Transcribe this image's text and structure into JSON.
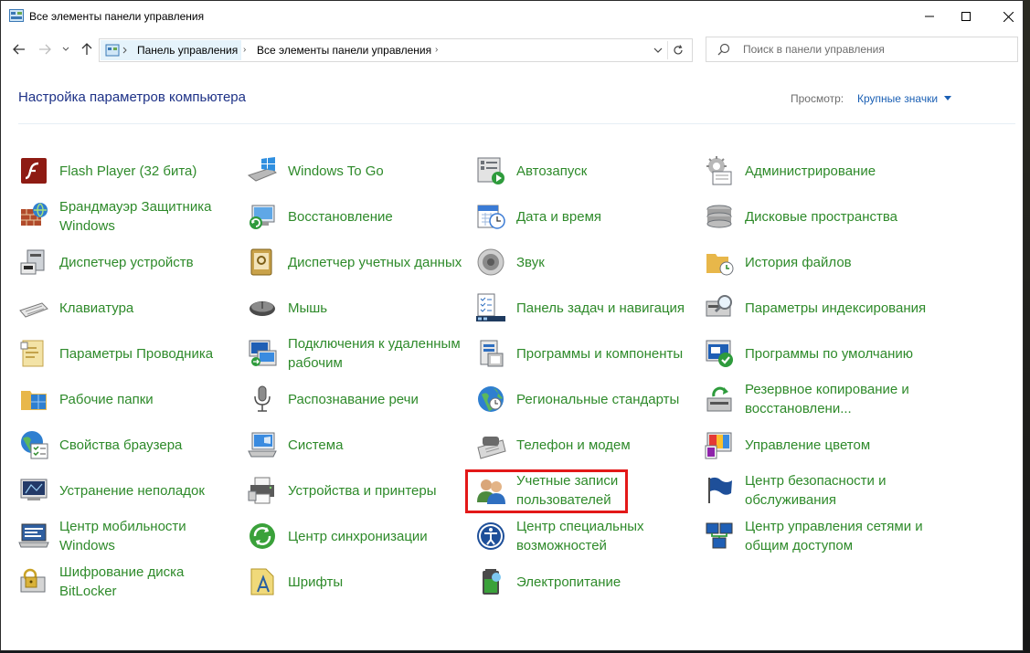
{
  "window": {
    "title": "Все элементы панели управления"
  },
  "address": {
    "crumbs": [
      "Панель управления",
      "Все элементы панели управления"
    ]
  },
  "search": {
    "placeholder": "Поиск в панели управления"
  },
  "header": {
    "title": "Настройка параметров компьютера",
    "view_label": "Просмотр:",
    "view_value": "Крупные значки"
  },
  "items": [
    {
      "label": "Flash Player (32 бита)",
      "icon": "flash-icon"
    },
    {
      "label": "Брандмауэр Защитника Windows",
      "icon": "firewall-icon"
    },
    {
      "label": "Диспетчер устройств",
      "icon": "device-manager-icon"
    },
    {
      "label": "Клавиатура",
      "icon": "keyboard-icon"
    },
    {
      "label": "Параметры Проводника",
      "icon": "explorer-options-icon"
    },
    {
      "label": "Рабочие папки",
      "icon": "work-folders-icon"
    },
    {
      "label": "Свойства браузера",
      "icon": "browser-icon"
    },
    {
      "label": "Устранение неполадок",
      "icon": "troubleshoot-icon"
    },
    {
      "label": "Центр мобильности Windows",
      "icon": "mobility-icon"
    },
    {
      "label": "Шифрование диска BitLocker",
      "icon": "bitlocker-icon"
    },
    {
      "label": "Windows To Go",
      "icon": "windows-to-go-icon"
    },
    {
      "label": "Восстановление",
      "icon": "recovery-icon"
    },
    {
      "label": "Диспетчер учетных данных",
      "icon": "credential-manager-icon"
    },
    {
      "label": "Мышь",
      "icon": "mouse-icon"
    },
    {
      "label": "Подключения к удаленным рабочим",
      "icon": "remote-desktop-icon"
    },
    {
      "label": "Распознавание речи",
      "icon": "microphone-icon"
    },
    {
      "label": "Система",
      "icon": "system-icon"
    },
    {
      "label": "Устройства и принтеры",
      "icon": "printer-icon"
    },
    {
      "label": "Центр синхронизации",
      "icon": "sync-icon"
    },
    {
      "label": "Шрифты",
      "icon": "fonts-icon"
    },
    {
      "label": "Автозапуск",
      "icon": "autoplay-icon"
    },
    {
      "label": "Дата и время",
      "icon": "calendar-icon"
    },
    {
      "label": "Звук",
      "icon": "speaker-icon"
    },
    {
      "label": "Панель задач и навигация",
      "icon": "taskbar-icon"
    },
    {
      "label": "Программы и компоненты",
      "icon": "programs-icon"
    },
    {
      "label": "Региональные стандарты",
      "icon": "region-icon"
    },
    {
      "label": "Телефон и модем",
      "icon": "phone-icon"
    },
    {
      "label": "Учетные записи пользователей",
      "icon": "users-icon"
    },
    {
      "label": "Центр специальных возможностей",
      "icon": "accessibility-icon"
    },
    {
      "label": "Электропитание",
      "icon": "power-icon"
    },
    {
      "label": "Администрирование",
      "icon": "admin-tools-icon"
    },
    {
      "label": "Дисковые пространства",
      "icon": "storage-spaces-icon"
    },
    {
      "label": "История файлов",
      "icon": "file-history-icon"
    },
    {
      "label": "Параметры индексирования",
      "icon": "indexing-icon"
    },
    {
      "label": "Программы по умолчанию",
      "icon": "default-programs-icon"
    },
    {
      "label": "Резервное копирование и восстановлени...",
      "icon": "backup-icon"
    },
    {
      "label": "Управление цветом",
      "icon": "color-management-icon"
    },
    {
      "label": "Центр безопасности и обслуживания",
      "icon": "security-flag-icon"
    },
    {
      "label": "Центр управления сетями и общим доступом",
      "icon": "network-icon"
    }
  ]
}
